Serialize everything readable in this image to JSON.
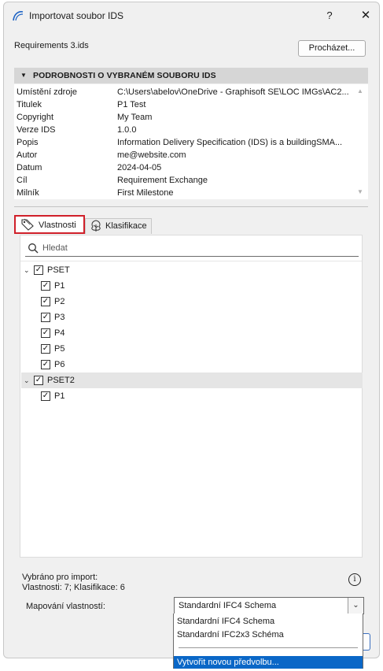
{
  "window": {
    "title": "Importovat soubor IDS",
    "help_label": "?",
    "close_label": "✕"
  },
  "file": {
    "name": "Requirements 3.ids",
    "browse_label": "Procházet..."
  },
  "details": {
    "header": "PODROBNOSTI O VYBRANÉM SOUBORU IDS",
    "rows": [
      {
        "key": "Umístění zdroje",
        "value": "C:\\Users\\abelov\\OneDrive - Graphisoft SE\\LOC IMGs\\AC2..."
      },
      {
        "key": "Titulek",
        "value": "P1 Test"
      },
      {
        "key": "Copyright",
        "value": "My Team"
      },
      {
        "key": "Verze IDS",
        "value": "1.0.0"
      },
      {
        "key": "Popis",
        "value": "Information Delivery Specification (IDS) is a buildingSMA..."
      },
      {
        "key": "Autor",
        "value": "me@website.com"
      },
      {
        "key": "Datum",
        "value": "2024-04-05"
      },
      {
        "key": "Cíl",
        "value": "Requirement Exchange"
      },
      {
        "key": "Milník",
        "value": "First Milestone"
      }
    ]
  },
  "tabs": [
    {
      "label": "Vlastnosti",
      "active": true,
      "icon": "tag-icon"
    },
    {
      "label": "Klasifikace",
      "active": false,
      "icon": "tree-icon"
    }
  ],
  "search": {
    "placeholder": "Hledat",
    "value": ""
  },
  "tree": [
    {
      "label": "PSET",
      "level": 0,
      "checked": true,
      "expanded": true,
      "selected": false
    },
    {
      "label": "P1",
      "level": 1,
      "checked": true,
      "selected": false
    },
    {
      "label": "P2",
      "level": 1,
      "checked": true,
      "selected": false
    },
    {
      "label": "P3",
      "level": 1,
      "checked": true,
      "selected": false
    },
    {
      "label": "P4",
      "level": 1,
      "checked": true,
      "selected": false
    },
    {
      "label": "P5",
      "level": 1,
      "checked": true,
      "selected": false
    },
    {
      "label": "P6",
      "level": 1,
      "checked": true,
      "selected": false
    },
    {
      "label": "PSET2",
      "level": 0,
      "checked": true,
      "expanded": true,
      "selected": true
    },
    {
      "label": "P1",
      "level": 1,
      "checked": true,
      "selected": false
    }
  ],
  "summary": {
    "label": "Vybráno pro import:",
    "counts": "Vlastnosti: 7; Klasifikace: 6"
  },
  "mapping": {
    "label": "Mapování vlastností:",
    "selected": "Standardní IFC4 Schema",
    "options": [
      "Standardní IFC4 Schema",
      "Standardní IFC2x3 Schéma"
    ],
    "create_option": "Vytvořit novou předvolbu..."
  },
  "colors": {
    "highlight": "#0a67c7",
    "tab_border": "#d0202a",
    "header_bg": "#d6d6d6",
    "dialog_bg": "#f0f0f0"
  }
}
